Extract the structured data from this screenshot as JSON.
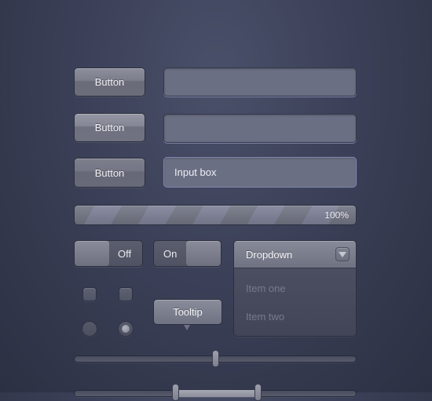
{
  "buttons": [
    {
      "label": "Button",
      "state": "normal"
    },
    {
      "label": "Button",
      "state": "hover"
    },
    {
      "label": "Button",
      "state": "pressed"
    }
  ],
  "inputs": [
    {
      "value": "",
      "placeholder": "",
      "state": "normal"
    },
    {
      "value": "",
      "placeholder": "",
      "state": "normal"
    },
    {
      "value": "Input box",
      "placeholder": "",
      "state": "focused"
    }
  ],
  "progress": {
    "value_percent": 100,
    "label": "100%"
  },
  "toggles": [
    {
      "label": "Off",
      "state": "off"
    },
    {
      "label": "On",
      "state": "on"
    }
  ],
  "dropdown": {
    "label": "Dropdown",
    "icon": "triangle-down-icon",
    "items": [
      {
        "label": "Item one"
      },
      {
        "label": "Item two"
      }
    ]
  },
  "checkboxes": [
    {
      "checked": false
    },
    {
      "checked": false
    }
  ],
  "radios": [
    {
      "selected": false
    },
    {
      "selected": true
    }
  ],
  "tooltip": {
    "label": "Tooltip"
  },
  "slider": {
    "value_fraction": 0.5
  },
  "range_slider": {
    "low_fraction": 0.36,
    "high_fraction": 0.65
  }
}
